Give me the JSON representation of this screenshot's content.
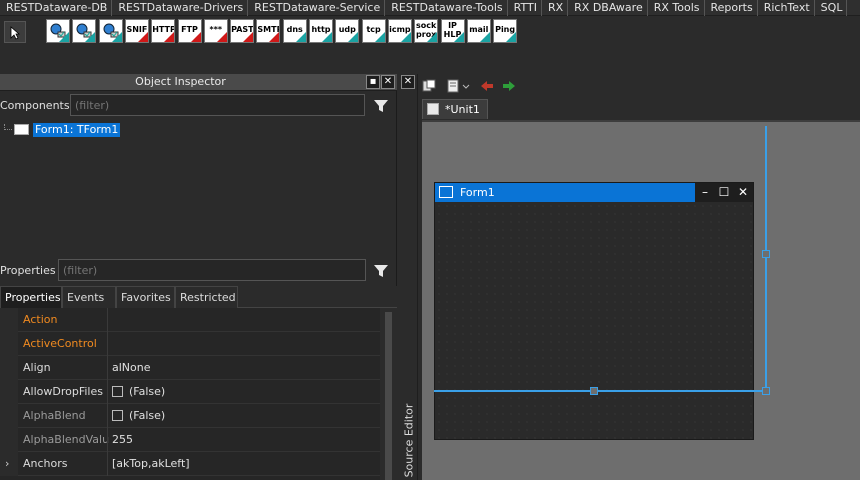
{
  "palette_tabs": [
    "RESTDataware-DB",
    "RESTDataware-Drivers",
    "RESTDataware-Service",
    "RESTDataware-Tools",
    "RTTI",
    "RX",
    "RX DBAware",
    "RX Tools",
    "Reports",
    "RichText",
    "SQL"
  ],
  "palette_icons": [
    {
      "name": "pic-globe-1",
      "label": "",
      "accent": "teal"
    },
    {
      "name": "pic-globe-2",
      "label": "",
      "accent": "teal"
    },
    {
      "name": "pic-globe-3",
      "label": "",
      "accent": "teal"
    },
    {
      "name": "snif",
      "label": "SNIF",
      "accent": "red"
    },
    {
      "name": "http-red",
      "label": "HTTP",
      "accent": "red"
    },
    {
      "name": "ftp",
      "label": "FTP",
      "accent": "red"
    },
    {
      "name": "stars",
      "label": "***",
      "accent": "red"
    },
    {
      "name": "past",
      "label": "PAST",
      "accent": "red"
    },
    {
      "name": "smtp",
      "label": "SMTP",
      "accent": "red"
    },
    {
      "name": "dns",
      "label": "dns",
      "accent": "teal"
    },
    {
      "name": "http",
      "label": "http",
      "accent": "teal"
    },
    {
      "name": "udp",
      "label": "udp",
      "accent": "teal"
    },
    {
      "name": "tcp",
      "label": "tcp",
      "accent": "teal"
    },
    {
      "name": "icmp",
      "label": "icmp",
      "accent": "teal"
    },
    {
      "name": "sock-prox",
      "label": "sock\nprox",
      "accent": "teal"
    },
    {
      "name": "ip-hlp",
      "label": "IP\nHLP",
      "accent": "teal"
    },
    {
      "name": "mail",
      "label": "mail",
      "accent": "teal"
    },
    {
      "name": "ping",
      "label": "Ping",
      "accent": "teal"
    }
  ],
  "object_inspector": {
    "title": "Object Inspector",
    "components_label": "Components",
    "components_filter_placeholder": "(filter)",
    "tree_root": "Form1: TForm1",
    "properties_label": "Properties",
    "properties_filter_placeholder": "(filter)",
    "tabs": [
      "Properties",
      "Events",
      "Favorites",
      "Restricted"
    ],
    "rows": [
      {
        "name": "Action",
        "value": "",
        "kind": "event"
      },
      {
        "name": "ActiveControl",
        "value": "",
        "kind": "event"
      },
      {
        "name": "Align",
        "value": "alNone",
        "kind": "normal"
      },
      {
        "name": "AllowDropFiles",
        "value": "(False)",
        "kind": "check"
      },
      {
        "name": "AlphaBlend",
        "value": "(False)",
        "kind": "check-dim"
      },
      {
        "name": "AlphaBlendValu",
        "value": "255",
        "kind": "dim"
      },
      {
        "name": "Anchors",
        "value": "[akTop,akLeft]",
        "kind": "expand"
      }
    ]
  },
  "source_editor_label": "Source Editor",
  "designer": {
    "unit_tab": "*Unit1",
    "form_caption": "Form1"
  },
  "colors": {
    "accent_blue": "#0a74d6",
    "event_orange": "#f08a20",
    "selection": "#3aa0e8"
  }
}
